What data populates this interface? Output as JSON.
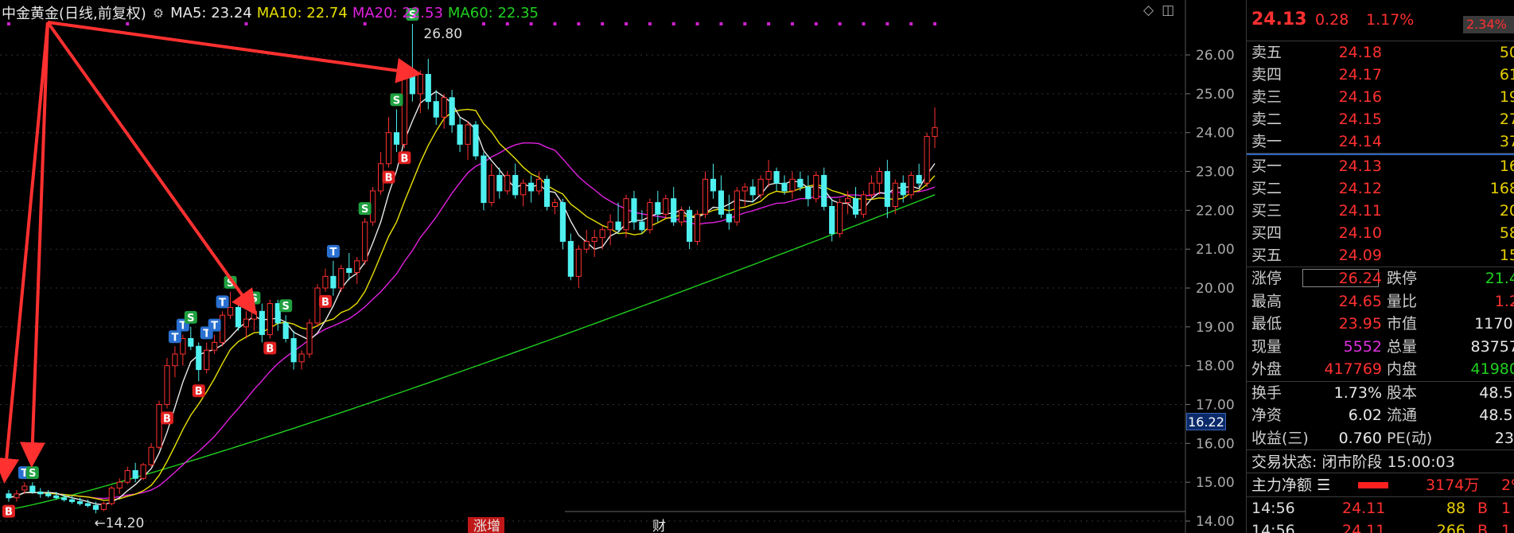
{
  "legend": {
    "title": "中金黄金(日线,前复权)",
    "ma5": "MA5: 23.24",
    "ma10": "MA10: 22.74",
    "ma20": "MA20: 22.53",
    "ma60": "MA60: 22.35"
  },
  "colors": {
    "up": "#ff3030",
    "down": "#4ff0f0",
    "ma5": "#e8e8e8",
    "ma10": "#e8e000",
    "ma20": "#e020e0",
    "ma60": "#20d020"
  },
  "chart_data": {
    "type": "candlestick",
    "ylim": [
      14.0,
      26.8
    ],
    "y_ticks": [
      "26.00",
      "25.00",
      "24.00",
      "23.00",
      "22.00",
      "21.00",
      "20.00",
      "19.00",
      "18.00",
      "17.00",
      "16.00",
      "15.00",
      "14.00"
    ],
    "high_label": "26.80",
    "low_label": "←14.20",
    "current_price_tag": "16.22",
    "bottom_labels": [
      "涨增",
      "财"
    ],
    "candles": [
      [
        14.7,
        14.8,
        14.5,
        14.6
      ],
      [
        14.6,
        14.8,
        14.5,
        14.7
      ],
      [
        14.8,
        15.0,
        14.7,
        14.9
      ],
      [
        14.9,
        15.0,
        14.7,
        14.75
      ],
      [
        14.75,
        14.85,
        14.6,
        14.7
      ],
      [
        14.7,
        14.8,
        14.6,
        14.65
      ],
      [
        14.65,
        14.75,
        14.55,
        14.6
      ],
      [
        14.6,
        14.7,
        14.5,
        14.55
      ],
      [
        14.55,
        14.65,
        14.45,
        14.5
      ],
      [
        14.5,
        14.6,
        14.4,
        14.45
      ],
      [
        14.45,
        14.55,
        14.35,
        14.4
      ],
      [
        14.4,
        14.5,
        14.2,
        14.3
      ],
      [
        14.3,
        14.5,
        14.25,
        14.45
      ],
      [
        14.45,
        14.9,
        14.4,
        14.85
      ],
      [
        14.85,
        15.1,
        14.7,
        15.0
      ],
      [
        15.0,
        15.4,
        14.95,
        15.3
      ],
      [
        15.3,
        15.5,
        15.0,
        15.1
      ],
      [
        15.1,
        15.5,
        15.05,
        15.45
      ],
      [
        15.45,
        16.0,
        15.4,
        15.9
      ],
      [
        15.9,
        17.1,
        15.85,
        17.0
      ],
      [
        17.0,
        18.2,
        16.9,
        18.0
      ],
      [
        18.0,
        18.5,
        17.7,
        18.3
      ],
      [
        18.3,
        18.8,
        18.0,
        18.7
      ],
      [
        18.7,
        19.0,
        18.4,
        18.5
      ],
      [
        18.5,
        18.6,
        17.6,
        17.9
      ],
      [
        17.9,
        18.6,
        17.8,
        18.4
      ],
      [
        18.4,
        18.8,
        18.3,
        18.6
      ],
      [
        18.6,
        19.4,
        18.5,
        19.3
      ],
      [
        19.3,
        19.9,
        19.2,
        19.5
      ],
      [
        19.5,
        19.6,
        18.9,
        19.0
      ],
      [
        19.0,
        19.4,
        18.7,
        19.2
      ],
      [
        19.2,
        19.5,
        18.9,
        19.4
      ],
      [
        19.4,
        19.6,
        18.6,
        18.8
      ],
      [
        18.8,
        19.7,
        18.7,
        19.6
      ],
      [
        19.6,
        19.7,
        18.9,
        19.1
      ],
      [
        19.1,
        19.3,
        18.6,
        18.7
      ],
      [
        18.7,
        18.9,
        17.9,
        18.1
      ],
      [
        18.1,
        18.4,
        17.9,
        18.3
      ],
      [
        18.3,
        19.2,
        18.2,
        19.1
      ],
      [
        19.1,
        20.1,
        19.0,
        20.0
      ],
      [
        20.0,
        20.5,
        19.9,
        20.3
      ],
      [
        20.3,
        20.7,
        19.8,
        20.0
      ],
      [
        20.0,
        20.6,
        19.9,
        20.5
      ],
      [
        20.5,
        20.9,
        20.2,
        20.4
      ],
      [
        20.4,
        20.8,
        20.1,
        20.7
      ],
      [
        20.7,
        21.8,
        20.6,
        21.7
      ],
      [
        21.7,
        22.6,
        21.6,
        22.5
      ],
      [
        22.5,
        23.5,
        22.4,
        23.2
      ],
      [
        23.2,
        24.4,
        23.1,
        24.0
      ],
      [
        24.0,
        24.6,
        23.5,
        23.7
      ],
      [
        23.7,
        25.8,
        23.6,
        25.6
      ],
      [
        25.6,
        26.8,
        24.8,
        25.0
      ],
      [
        25.0,
        25.6,
        24.5,
        25.5
      ],
      [
        25.5,
        25.9,
        24.6,
        24.8
      ],
      [
        24.8,
        25.1,
        24.2,
        24.4
      ],
      [
        24.4,
        25.0,
        24.1,
        24.9
      ],
      [
        24.9,
        25.1,
        24.0,
        24.2
      ],
      [
        24.2,
        24.4,
        23.5,
        23.7
      ],
      [
        23.7,
        24.3,
        23.3,
        24.2
      ],
      [
        24.2,
        24.3,
        23.3,
        23.4
      ],
      [
        23.4,
        23.5,
        22.0,
        22.2
      ],
      [
        22.2,
        23.2,
        22.1,
        22.9
      ],
      [
        22.9,
        23.1,
        22.3,
        22.5
      ],
      [
        22.5,
        23.0,
        22.4,
        22.9
      ],
      [
        22.9,
        23.2,
        22.3,
        22.4
      ],
      [
        22.4,
        22.8,
        22.1,
        22.7
      ],
      [
        22.7,
        22.9,
        22.2,
        22.5
      ],
      [
        22.5,
        23.0,
        22.4,
        22.8
      ],
      [
        22.8,
        22.9,
        22.0,
        22.1
      ],
      [
        22.1,
        22.3,
        21.9,
        22.2
      ],
      [
        22.2,
        22.3,
        21.0,
        21.2
      ],
      [
        21.2,
        21.4,
        20.2,
        20.3
      ],
      [
        20.3,
        21.1,
        20.0,
        21.0
      ],
      [
        21.0,
        21.5,
        20.9,
        21.2
      ],
      [
        21.2,
        21.5,
        20.8,
        21.3
      ],
      [
        21.3,
        21.6,
        21.0,
        21.5
      ],
      [
        21.5,
        21.9,
        21.1,
        21.7
      ],
      [
        21.7,
        22.2,
        21.4,
        21.5
      ],
      [
        21.5,
        22.4,
        21.3,
        22.3
      ],
      [
        22.3,
        22.5,
        21.5,
        21.7
      ],
      [
        21.7,
        22.0,
        21.4,
        21.5
      ],
      [
        21.5,
        22.3,
        21.4,
        22.2
      ],
      [
        22.2,
        22.5,
        21.7,
        21.9
      ],
      [
        21.9,
        22.4,
        21.8,
        22.3
      ],
      [
        22.3,
        22.6,
        21.6,
        21.7
      ],
      [
        21.7,
        22.1,
        21.6,
        22.0
      ],
      [
        22.0,
        22.1,
        21.0,
        21.2
      ],
      [
        21.2,
        22.0,
        21.1,
        21.9
      ],
      [
        21.9,
        23.0,
        21.8,
        22.8
      ],
      [
        22.8,
        23.2,
        22.3,
        22.5
      ],
      [
        22.5,
        22.9,
        21.8,
        21.9
      ],
      [
        21.9,
        22.4,
        21.5,
        21.7
      ],
      [
        21.7,
        22.6,
        21.6,
        22.5
      ],
      [
        22.5,
        22.7,
        22.1,
        22.6
      ],
      [
        22.6,
        22.8,
        22.2,
        22.4
      ],
      [
        22.4,
        22.9,
        22.3,
        22.8
      ],
      [
        22.8,
        23.3,
        22.6,
        23.0
      ],
      [
        23.0,
        23.1,
        22.5,
        22.7
      ],
      [
        22.7,
        22.9,
        22.4,
        22.5
      ],
      [
        22.5,
        23.0,
        22.3,
        22.8
      ],
      [
        22.8,
        23.0,
        22.5,
        22.6
      ],
      [
        22.6,
        22.9,
        22.1,
        22.3
      ],
      [
        22.3,
        23.0,
        22.2,
        22.9
      ],
      [
        22.9,
        23.1,
        22.0,
        22.1
      ],
      [
        22.1,
        22.3,
        21.2,
        21.4
      ],
      [
        21.4,
        22.3,
        21.3,
        22.2
      ],
      [
        22.2,
        22.5,
        21.9,
        22.3
      ],
      [
        22.3,
        22.6,
        21.8,
        21.9
      ],
      [
        21.9,
        22.5,
        21.8,
        22.4
      ],
      [
        22.4,
        22.9,
        22.3,
        22.7
      ],
      [
        22.7,
        23.1,
        22.4,
        23.0
      ],
      [
        23.0,
        23.3,
        21.8,
        22.1
      ],
      [
        22.1,
        22.8,
        21.9,
        22.7
      ],
      [
        22.7,
        22.9,
        22.2,
        22.4
      ],
      [
        22.4,
        23.0,
        22.3,
        22.9
      ],
      [
        22.9,
        23.2,
        22.6,
        22.7
      ],
      [
        22.7,
        24.0,
        22.6,
        23.9
      ],
      [
        23.9,
        24.65,
        23.6,
        24.13
      ]
    ],
    "markers": [
      {
        "i": 0,
        "tag": "B"
      },
      {
        "i": 2,
        "tag": "T"
      },
      {
        "i": 3,
        "tag": "S"
      },
      {
        "i": 20,
        "tag": "B"
      },
      {
        "i": 21,
        "tag": "T"
      },
      {
        "i": 22,
        "tag": "T"
      },
      {
        "i": 23,
        "tag": "S"
      },
      {
        "i": 24,
        "tag": "B"
      },
      {
        "i": 25,
        "tag": "T"
      },
      {
        "i": 26,
        "tag": "T"
      },
      {
        "i": 27,
        "tag": "T"
      },
      {
        "i": 28,
        "tag": "S"
      },
      {
        "i": 31,
        "tag": "S"
      },
      {
        "i": 33,
        "tag": "B"
      },
      {
        "i": 35,
        "tag": "S"
      },
      {
        "i": 40,
        "tag": "B"
      },
      {
        "i": 41,
        "tag": "T"
      },
      {
        "i": 45,
        "tag": "S"
      },
      {
        "i": 48,
        "tag": "B"
      },
      {
        "i": 49,
        "tag": "S"
      },
      {
        "i": 50,
        "tag": "B"
      },
      {
        "i": 51,
        "tag": "S"
      }
    ]
  },
  "quote": {
    "price": "24.13",
    "change": "0.28",
    "pct": "1.17%",
    "badge": "2.34%"
  },
  "asks": [
    {
      "label": "卖五",
      "price": "24.18",
      "vol": "50"
    },
    {
      "label": "卖四",
      "price": "24.17",
      "vol": "61"
    },
    {
      "label": "卖三",
      "price": "24.16",
      "vol": "19"
    },
    {
      "label": "卖二",
      "price": "24.15",
      "vol": "27"
    },
    {
      "label": "卖一",
      "price": "24.14",
      "vol": "37"
    }
  ],
  "bids": [
    {
      "label": "买一",
      "price": "24.13",
      "vol": "16"
    },
    {
      "label": "买二",
      "price": "24.12",
      "vol": "168"
    },
    {
      "label": "买三",
      "price": "24.11",
      "vol": "20"
    },
    {
      "label": "买四",
      "price": "24.10",
      "vol": "58"
    },
    {
      "label": "买五",
      "price": "24.09",
      "vol": "15"
    }
  ],
  "stats": [
    {
      "l1": "涨停",
      "v1": "26.24",
      "c1": "red",
      "l2": "跌停",
      "v2": "21.4",
      "c2": "green"
    },
    {
      "l1": "最高",
      "v1": "24.65",
      "c1": "red",
      "l2": "量比",
      "v2": "1.2",
      "c2": "red"
    },
    {
      "l1": "最低",
      "v1": "23.95",
      "c1": "red",
      "l2": "市值",
      "v2": "1170(",
      "c2": "white"
    },
    {
      "l1": "现量",
      "v1": "5552",
      "c1": "mag",
      "l2": "总量",
      "v2": "83757",
      "c2": "white"
    },
    {
      "l1": "外盘",
      "v1": "417769",
      "c1": "red",
      "l2": "内盘",
      "v2": "41980",
      "c2": "green"
    }
  ],
  "stats2": [
    {
      "l1": "换手",
      "v1": "1.73%",
      "l2": "股本",
      "v2": "48.5("
    },
    {
      "l1": "净资",
      "v1": "6.02",
      "l2": "流通",
      "v2": "48.5("
    },
    {
      "l1": "收益(三)",
      "v1": "0.760",
      "l2": "PE(动)",
      "v2": "23."
    }
  ],
  "status": "交易状态: 闭市阶段 15:00:03",
  "main_flow": {
    "label": "主力净额",
    "value": "3174万",
    "tail": "2%"
  },
  "ticks": [
    {
      "time": "14:56",
      "price": "24.11",
      "qty": "88",
      "dir": "B",
      "extra": "1"
    },
    {
      "time": "14:56",
      "price": "24.11",
      "qty": "266",
      "dir": "B",
      "extra": "1"
    }
  ]
}
